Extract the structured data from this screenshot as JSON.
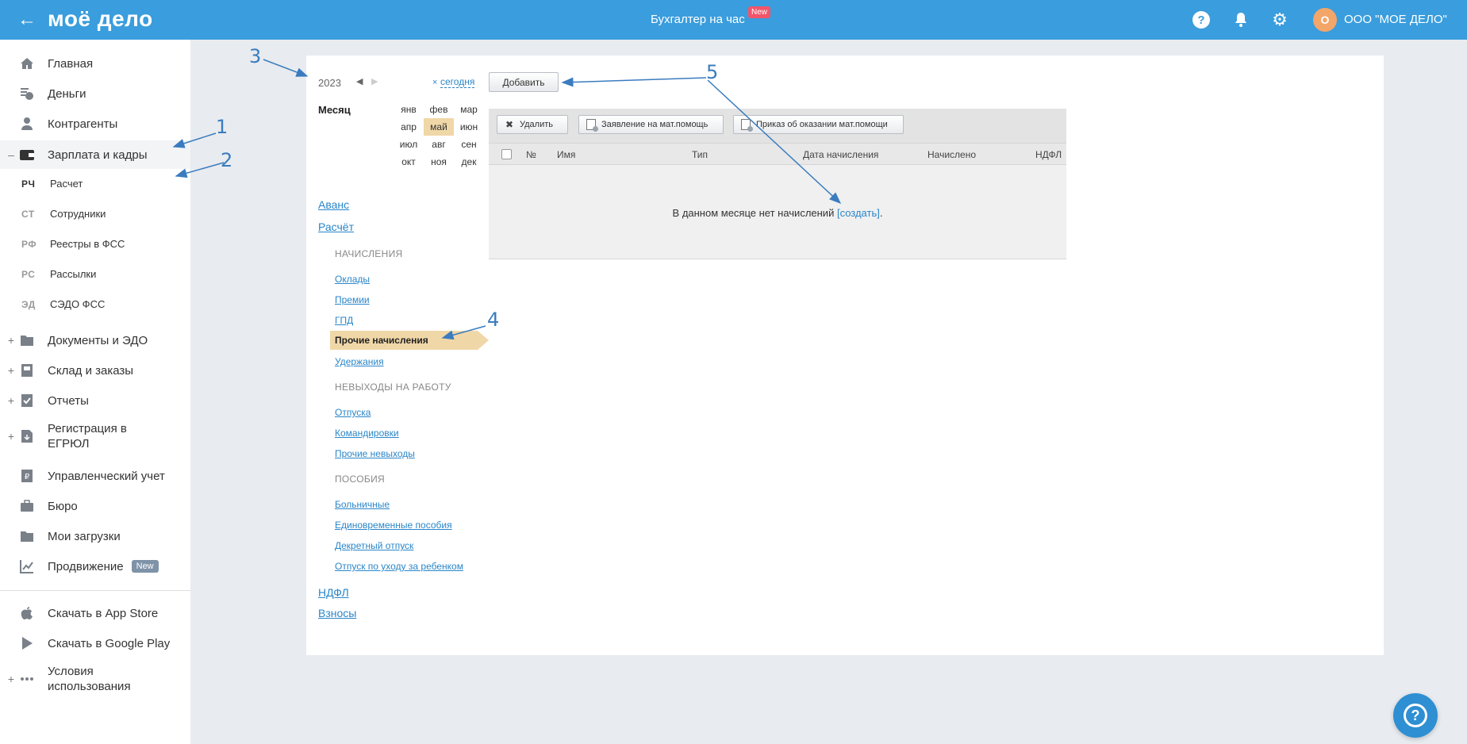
{
  "header": {
    "logo": "моё дело",
    "center_title": "Бухгалтер на час",
    "center_badge": "New",
    "avatar_letter": "О",
    "company": "ООО \"МОЕ ДЕЛО\""
  },
  "sidebar": {
    "items": [
      {
        "label": "Главная",
        "icon": "home-icon"
      },
      {
        "label": "Деньги",
        "icon": "money-icon"
      },
      {
        "label": "Контрагенты",
        "icon": "contractors-icon"
      },
      {
        "label": "Зарплата и кадры",
        "icon": "wallet-icon",
        "prefix": "–"
      },
      {
        "label": "Документы и ЭДО",
        "icon": "folder-icon",
        "prefix": "+"
      },
      {
        "label": "Склад и заказы",
        "icon": "warehouse-icon",
        "prefix": "+"
      },
      {
        "label": "Отчеты",
        "icon": "report-icon",
        "prefix": "+"
      },
      {
        "label": "Регистрация в ЕГРЮЛ",
        "icon": "registration-icon",
        "prefix": "+"
      },
      {
        "label": "Управленческий учет",
        "icon": "ruble-doc-icon"
      },
      {
        "label": "Бюро",
        "icon": "briefcase-icon"
      },
      {
        "label": "Мои загрузки",
        "icon": "downloads-folder-icon"
      },
      {
        "label": "Продвижение",
        "icon": "chart-icon",
        "badge": "New"
      },
      {
        "label": "Скачать в App Store",
        "icon": "apple-icon"
      },
      {
        "label": "Скачать в Google Play",
        "icon": "play-icon"
      },
      {
        "label": "Условия использования",
        "icon": "dots-icon",
        "prefix": "+"
      }
    ],
    "subitems": [
      {
        "abbr": "РЧ",
        "label": "Расчет"
      },
      {
        "abbr": "СТ",
        "label": "Сотрудники"
      },
      {
        "abbr": "РФ",
        "label": "Реестры в ФСС"
      },
      {
        "abbr": "РС",
        "label": "Рассылки"
      },
      {
        "abbr": "ЭД",
        "label": "СЭДО ФСС"
      }
    ]
  },
  "calendar": {
    "year": "2023",
    "today_x": "×",
    "today": "сегодня",
    "month_label": "Месяц",
    "months": [
      "янв",
      "фев",
      "мар",
      "апр",
      "май",
      "июн",
      "июл",
      "авг",
      "сен",
      "окт",
      "ноя",
      "дек"
    ],
    "selected_month": "май"
  },
  "nav": {
    "avans": "Аванс",
    "raschet": "Расчёт",
    "accruals_head": "НАЧИСЛЕНИЯ",
    "accruals": [
      "Оклады",
      "Премии",
      "ГПД"
    ],
    "active_accrual": "Прочие начисления",
    "deductions": "Удержания",
    "absence_head": "НЕВЫХОДЫ НА РАБОТУ",
    "absences": [
      "Отпуска",
      "Командировки",
      "Прочие невыходы"
    ],
    "benefits_head": "ПОСОБИЯ",
    "benefits": [
      "Больничные",
      "Единовременные пособия",
      "Декретный отпуск",
      "Отпуск по уходу за ребенком"
    ],
    "ndfl": "НДФЛ",
    "contributions": "Взносы"
  },
  "actions": {
    "add": "Добавить",
    "delete": "Удалить",
    "application": "Заявление на мат.помощь",
    "order": "Приказ об оказании мат.помощи"
  },
  "table": {
    "columns": [
      "№",
      "Имя",
      "Тип",
      "Дата начисления",
      "Начислено",
      "НДФЛ"
    ],
    "empty_text": "В данном месяце нет начислений ",
    "empty_link": "[создать]",
    "empty_suffix": "."
  },
  "annotations": [
    "1",
    "2",
    "3",
    "4",
    "5"
  ],
  "colors": {
    "header_bg": "#3a9ddd",
    "accent": "#2a86c9",
    "selected": "#f0d7a7",
    "annotation": "#3a7cbf"
  }
}
